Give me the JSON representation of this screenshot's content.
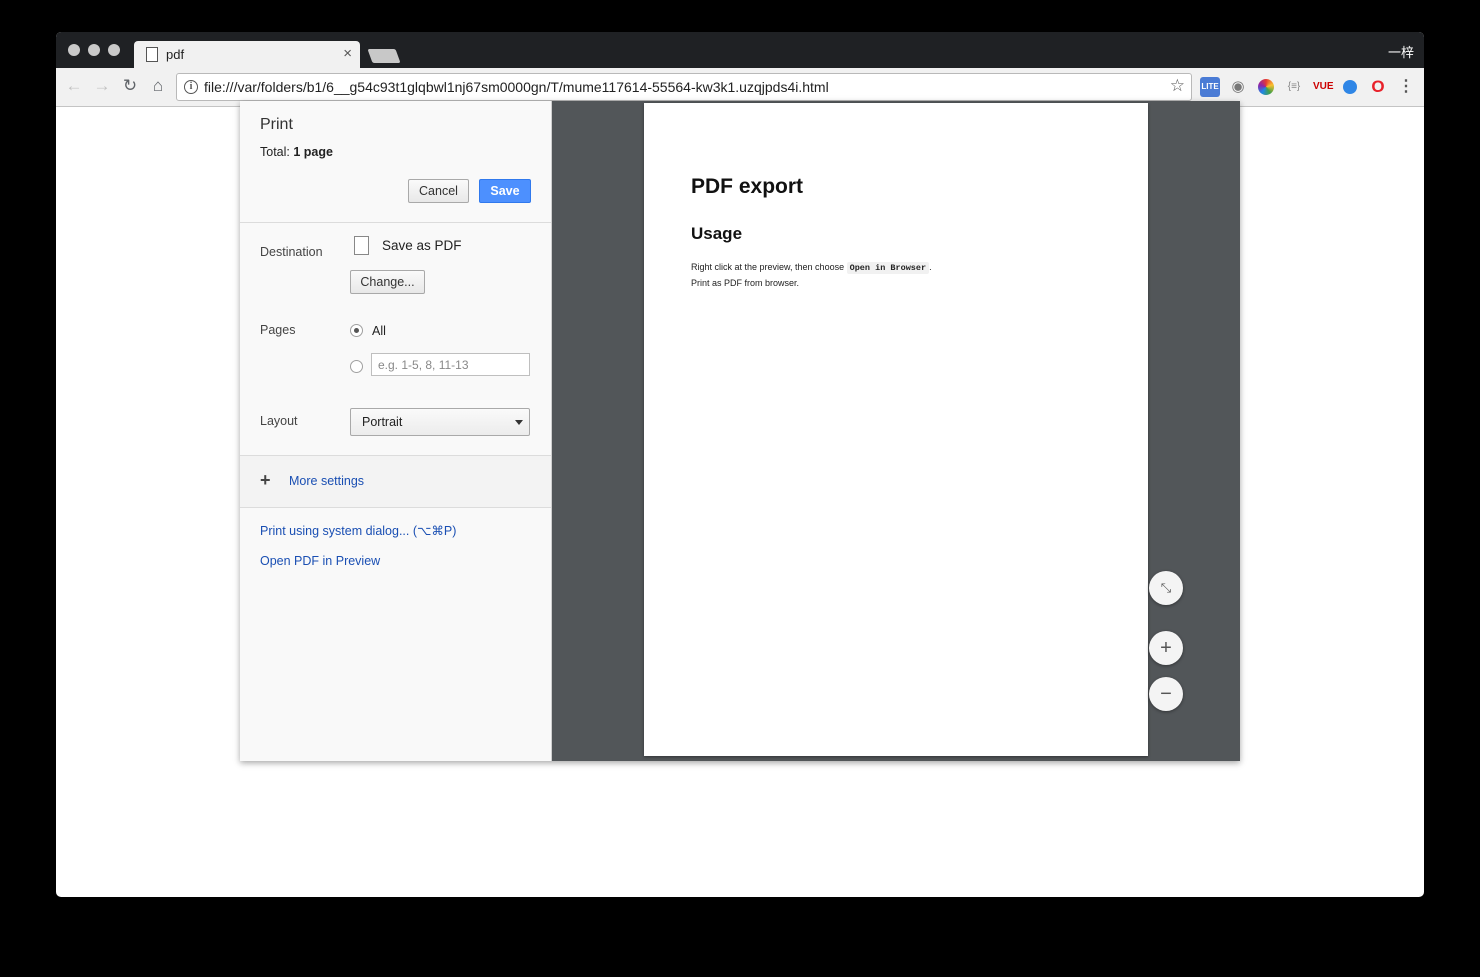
{
  "browser": {
    "tab_title": "pdf",
    "tab_close": "×",
    "profile_name": "一梓",
    "url": "file:///var/folders/b1/6__g54c93t1glqbwl1nj67sm0000gn/T/mume117614-55564-kw3k1.uzqjpds4i.html",
    "nav": {
      "back": "←",
      "forward": "→",
      "reload": "↻",
      "home": "⌂"
    },
    "star": "☆",
    "extensions": {
      "lite": "LITE",
      "camera": "◉",
      "json": "{≡}",
      "vue": "VUE",
      "opera": "O",
      "menu": "⋮"
    }
  },
  "print": {
    "title": "Print",
    "total_prefix": "Total: ",
    "total_value": "1 page",
    "cancel_label": "Cancel",
    "save_label": "Save",
    "destination_label": "Destination",
    "destination_name": "Save as PDF",
    "change_label": "Change...",
    "pages_label": "Pages",
    "pages_all_label": "All",
    "pages_placeholder": "e.g. 1-5, 8, 11-13",
    "layout_label": "Layout",
    "layout_value": "Portrait",
    "more_settings_label": "More settings",
    "more_settings_icon": "+",
    "system_dialog_link": "Print using system dialog... (⌥⌘P)",
    "open_preview_link": "Open PDF in Preview"
  },
  "preview": {
    "heading1": "PDF export",
    "heading2": "Usage",
    "para1_before": "Right click at the preview, then choose ",
    "para1_code": "Open in Browser",
    "para1_after": ".",
    "para2": "Print as PDF from browser.",
    "zoom_fit_icon": "⤡",
    "zoom_in_icon": "+",
    "zoom_out_icon": "−"
  }
}
